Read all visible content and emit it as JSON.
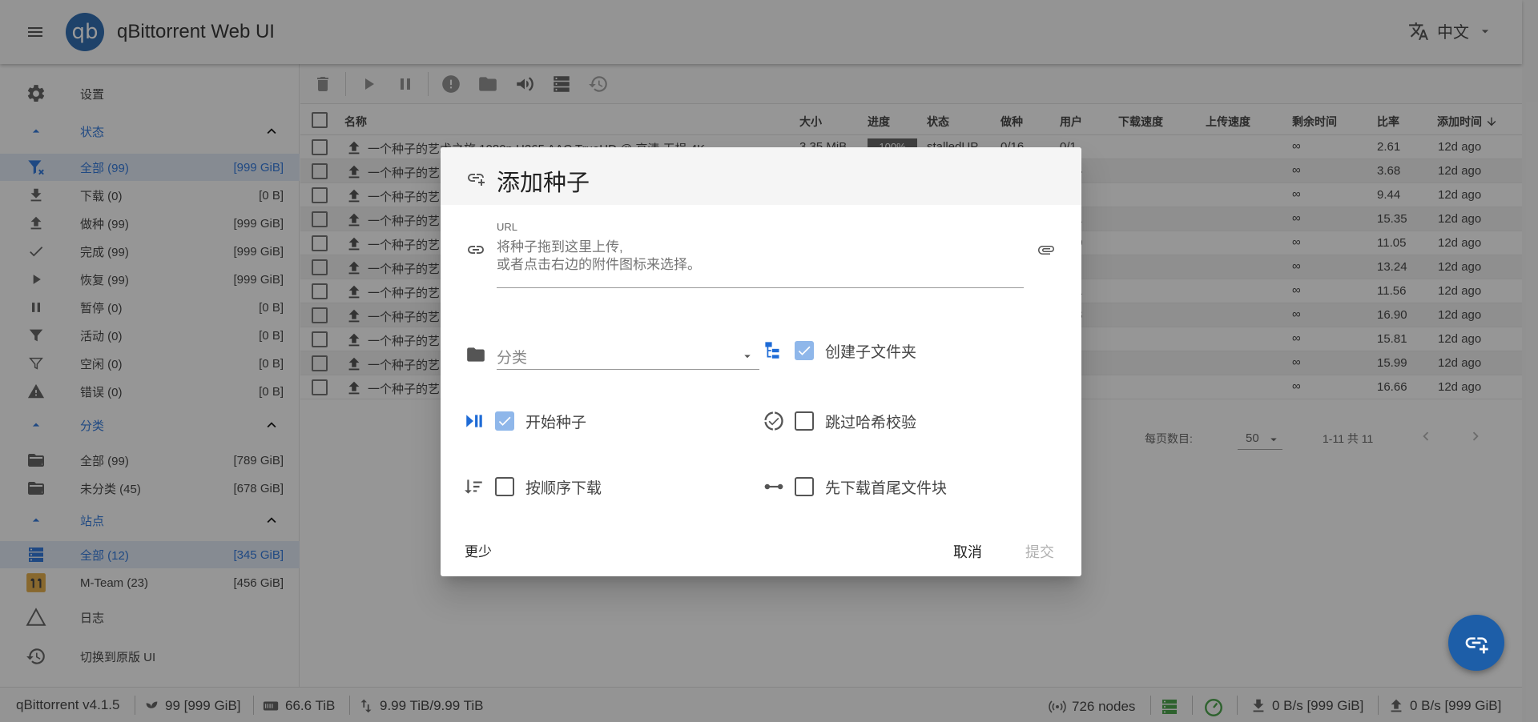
{
  "app": {
    "title": "qBittorrent Web UI",
    "logo_text": "qb",
    "language": "中文"
  },
  "sidebar": {
    "settings": "设置",
    "status_header": "状态",
    "status_items": [
      {
        "label": "全部 (99)",
        "value": "[999 GiB]",
        "icon": "filter-all-icon",
        "active": true
      },
      {
        "label": "下载 (0)",
        "value": "[0 B]",
        "icon": "download-icon",
        "active": false
      },
      {
        "label": "做种 (99)",
        "value": "[999 GiB]",
        "icon": "upload-icon",
        "active": false
      },
      {
        "label": "完成 (99)",
        "value": "[999 GiB]",
        "icon": "check-icon",
        "active": false
      },
      {
        "label": "恢复 (99)",
        "value": "[999 GiB]",
        "icon": "play-icon",
        "active": false
      },
      {
        "label": "暂停 (0)",
        "value": "[0 B]",
        "icon": "pause-icon",
        "active": false
      },
      {
        "label": "活动 (0)",
        "value": "[0 B]",
        "icon": "filter-icon",
        "active": false
      },
      {
        "label": "空闲 (0)",
        "value": "[0 B]",
        "icon": "filter-outline-icon",
        "active": false
      },
      {
        "label": "错误 (0)",
        "value": "[0 B]",
        "icon": "alert-icon",
        "active": false
      }
    ],
    "category_header": "分类",
    "category_items": [
      {
        "label": "全部 (99)",
        "value": "[789 GiB]"
      },
      {
        "label": "未分类 (45)",
        "value": "[678 GiB]"
      }
    ],
    "site_header": "站点",
    "site_items": [
      {
        "label": "全部 (12)",
        "value": "[345 GiB]",
        "active": true
      },
      {
        "label": "M-Team (23)",
        "value": "[456 GiB]",
        "active": false
      }
    ],
    "log": "日志",
    "switch_ui": "切换到原版 UI"
  },
  "table": {
    "headers": {
      "name": "名称",
      "size": "大小",
      "progress": "进度",
      "state": "状态",
      "seeds": "做种",
      "peers": "用户",
      "dl_speed": "下载速度",
      "up_speed": "上传速度",
      "eta": "剩余时间",
      "ratio": "比率",
      "added": "添加时间"
    },
    "first_row": {
      "name": "一个种子的艺术之旅 1080p H265 AAC TrueHD @ 高清 无损 4K",
      "size": "3.35 MiB",
      "progress": "100%",
      "state": "stalledUP",
      "seeds": "0/16",
      "peers": "0/1"
    },
    "rows": [
      {
        "name": "一个种子的艺",
        "peers_tail": "",
        "eta": "∞",
        "ratio": "2.61",
        "added": "12d ago"
      },
      {
        "name": "一个种子的艺",
        "peers_tail": "4",
        "eta": "∞",
        "ratio": "3.68",
        "added": "12d ago"
      },
      {
        "name": "一个种子的艺",
        "peers_tail": "",
        "eta": "∞",
        "ratio": "9.44",
        "added": "12d ago"
      },
      {
        "name": "一个种子的艺",
        "peers_tail": "1",
        "eta": "∞",
        "ratio": "15.35",
        "added": "12d ago"
      },
      {
        "name": "一个种子的艺",
        "peers_tail": "0",
        "eta": "∞",
        "ratio": "11.05",
        "added": "12d ago"
      },
      {
        "name": "一个种子的艺",
        "peers_tail": "",
        "eta": "∞",
        "ratio": "13.24",
        "added": "12d ago"
      },
      {
        "name": "一个种子的艺",
        "peers_tail": "1",
        "eta": "∞",
        "ratio": "11.56",
        "added": "12d ago"
      },
      {
        "name": "一个种子的艺",
        "peers_tail": "3",
        "eta": "∞",
        "ratio": "16.90",
        "added": "12d ago"
      },
      {
        "name": "一个种子的艺",
        "peers_tail": "",
        "eta": "∞",
        "ratio": "15.81",
        "added": "12d ago"
      },
      {
        "name": "一个种子的艺",
        "peers_tail": "",
        "eta": "∞",
        "ratio": "15.99",
        "added": "12d ago"
      },
      {
        "name": "一个种子的艺",
        "peers_tail": "",
        "eta": "∞",
        "ratio": "16.66",
        "added": "12d ago"
      }
    ],
    "pager": {
      "per_page_label": "每页数目:",
      "per_page": "50",
      "info": "1-11 共 11"
    }
  },
  "statusbar": {
    "version": "qBittorrent v4.1.5",
    "torrents": "99 [999 GiB]",
    "free_space": "66.6 TiB",
    "alltime": "9.99 TiB/9.99 TiB",
    "dht": "726 nodes",
    "download": "0 B/s [999 GiB]",
    "upload": "0 B/s [999 GiB]"
  },
  "dialog": {
    "title": "添加种子",
    "url_label": "URL",
    "url_placeholder": "将种子拖到这里上传,\n或者点击右边的附件图标来选择。",
    "category_placeholder": "分类",
    "create_subfolder": "创建子文件夹",
    "start_torrent": "开始种子",
    "skip_hash_check": "跳过哈希校验",
    "sequential_download": "按顺序下载",
    "first_last_pieces": "先下载首尾文件块",
    "more": "更少",
    "cancel": "取消",
    "submit": "提交",
    "create_subfolder_checked": true,
    "start_torrent_checked": true,
    "skip_hash_check_checked": false,
    "sequential_download_checked": false,
    "first_last_pieces_checked": false
  },
  "colors": {
    "accent": "#1e6bd6",
    "logo": "#1d5ea8",
    "checkbox_on": "#8fb7ea"
  }
}
